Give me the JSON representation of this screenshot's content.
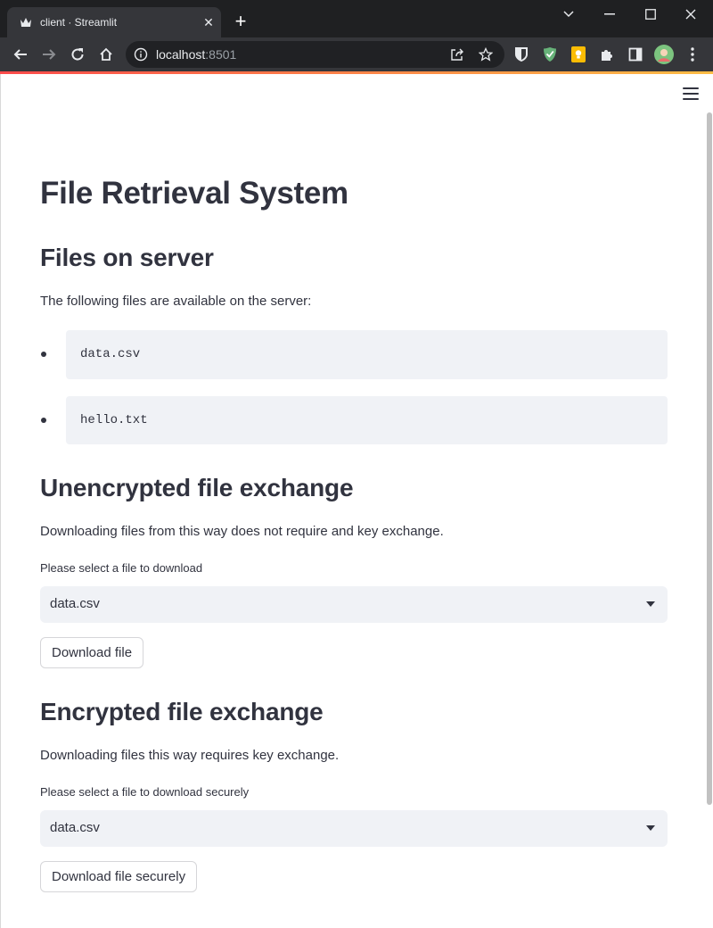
{
  "browser": {
    "tab": {
      "title": "client · Streamlit"
    },
    "address_bar": {
      "host": "localhost",
      "port": ":8501"
    }
  },
  "page": {
    "title": "File Retrieval System",
    "files_section": {
      "heading": "Files on server",
      "description": "The following files are available on the server:",
      "files": [
        "data.csv",
        "hello.txt"
      ]
    },
    "unencrypted_section": {
      "heading": "Unencrypted file exchange",
      "description": "Downloading files from this way does not require and key exchange.",
      "select_label": "Please select a file to download",
      "selected_value": "data.csv",
      "button_label": "Download file"
    },
    "encrypted_section": {
      "heading": "Encrypted file exchange",
      "description": "Downloading files this way requires key exchange.",
      "select_label": "Please select a file to download securely",
      "selected_value": "data.csv",
      "button_label": "Download file securely"
    }
  },
  "colors": {
    "text": "#31333f",
    "code_bg": "#f0f2f6",
    "chrome_dark": "#1f2022",
    "chrome_toolbar": "#35363a",
    "accent_gradient_start": "#ff4b4b",
    "accent_gradient_end": "#ffbd45"
  },
  "icons": {
    "tab_favicon": "streamlit-crown-icon",
    "toolbar": [
      "back-icon",
      "forward-icon",
      "reload-icon",
      "home-icon",
      "info-icon",
      "share-icon",
      "star-icon"
    ],
    "extensions": [
      "bitwarden-shield-icon",
      "adguard-shield-icon",
      "keep-note-icon",
      "puzzle-icon",
      "side-panel-icon",
      "profile-avatar-icon",
      "kebab-menu-icon"
    ],
    "app_menu": "hamburger-menu-icon"
  }
}
